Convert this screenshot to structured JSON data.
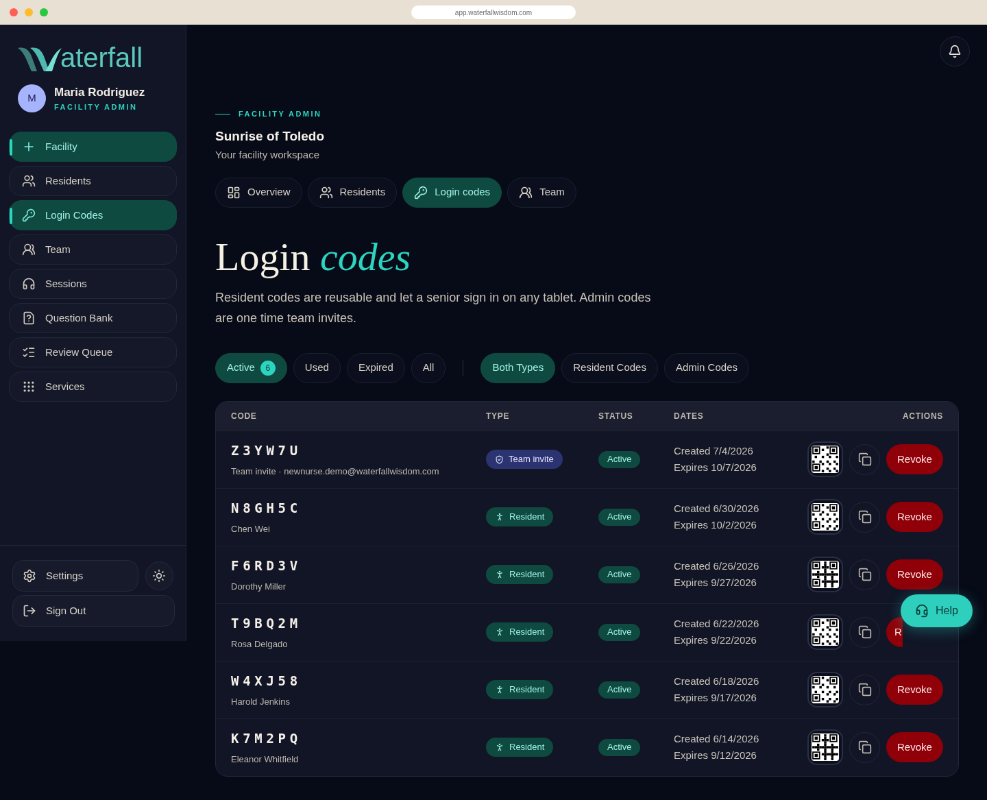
{
  "browser": {
    "url": "app.waterfallwisdom.com"
  },
  "sidebar": {
    "logo_text": "aterfall",
    "user": {
      "initial": "M",
      "name": "Maria Rodriguez",
      "role": "FACILITY ADMIN"
    },
    "items": [
      {
        "label": "Facility",
        "kind": "plus",
        "selected": true
      },
      {
        "label": "Residents",
        "kind": "users",
        "selected": false
      },
      {
        "label": "Login Codes",
        "kind": "key",
        "selected": true
      },
      {
        "label": "Team",
        "kind": "team",
        "selected": false
      },
      {
        "label": "Sessions",
        "kind": "headset",
        "selected": false
      },
      {
        "label": "Question Bank",
        "kind": "question",
        "selected": false
      },
      {
        "label": "Review Queue",
        "kind": "checklist",
        "selected": false
      },
      {
        "label": "Services",
        "kind": "grid",
        "selected": false
      }
    ],
    "settings": "Settings",
    "sign_out": "Sign Out"
  },
  "header": {
    "eyebrow": "FACILITY ADMIN",
    "title": "Sunrise of Toledo",
    "subtitle": "Your facility workspace"
  },
  "tabs": [
    {
      "label": "Overview",
      "kind": "overview",
      "selected": false
    },
    {
      "label": "Residents",
      "kind": "users",
      "selected": false
    },
    {
      "label": "Login codes",
      "kind": "key",
      "selected": true
    },
    {
      "label": "Team",
      "kind": "team",
      "selected": false
    }
  ],
  "page": {
    "title": "Login *codes*",
    "description": "Resident codes are reusable and let a senior sign in on any tablet. Admin codes are one time team invites."
  },
  "status_filters": [
    {
      "label": "Active",
      "count": "6",
      "selected": true
    },
    {
      "label": "Used",
      "selected": false
    },
    {
      "label": "Expired",
      "selected": false
    },
    {
      "label": "All",
      "selected": false
    }
  ],
  "type_filters": [
    {
      "label": "Both Types",
      "selected": true
    },
    {
      "label": "Resident Codes",
      "selected": false
    },
    {
      "label": "Admin Codes",
      "selected": false
    }
  ],
  "table": {
    "columns": [
      "CODE",
      "TYPE",
      "STATUS",
      "DATES",
      "ACTIONS"
    ],
    "rows": [
      {
        "code": "Z3YW7U",
        "detail": "Team invite · newnurse.demo@waterfallwisdom.com",
        "type": "Team invite",
        "kind": "team",
        "status": "Active",
        "created": "Created 7/4/2026",
        "expires": "Expires 10/7/2026",
        "action": "Revoke"
      },
      {
        "code": "N8GH5C",
        "detail": "Chen Wei",
        "type": "Resident",
        "kind": "resident",
        "status": "Active",
        "created": "Created 6/30/2026",
        "expires": "Expires 10/2/2026",
        "action": "Revoke"
      },
      {
        "code": "F6RD3V",
        "detail": "Dorothy Miller",
        "type": "Resident",
        "kind": "resident",
        "status": "Active",
        "created": "Created 6/26/2026",
        "expires": "Expires 9/27/2026",
        "action": "Revoke"
      },
      {
        "code": "T9BQ2M",
        "detail": "Rosa Delgado",
        "type": "Resident",
        "kind": "resident",
        "status": "Active",
        "created": "Created 6/22/2026",
        "expires": "Expires 9/22/2026",
        "action": "R"
      },
      {
        "code": "W4XJ58",
        "detail": "Harold Jenkins",
        "type": "Resident",
        "kind": "resident",
        "status": "Active",
        "created": "Created 6/18/2026",
        "expires": "Expires 9/17/2026",
        "action": "Revoke"
      },
      {
        "code": "K7M2PQ",
        "detail": "Eleanor Whitfield",
        "type": "Resident",
        "kind": "resident",
        "status": "Active",
        "created": "Created 6/14/2026",
        "expires": "Expires 9/12/2026",
        "action": "Revoke"
      }
    ]
  },
  "help": {
    "label": "Help"
  }
}
